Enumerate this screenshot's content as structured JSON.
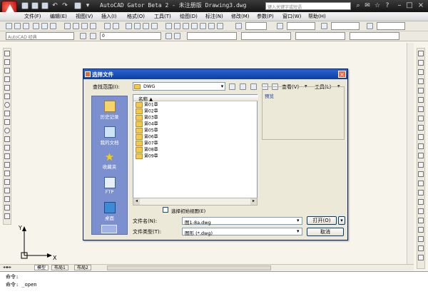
{
  "app": {
    "title": "AutoCAD Gator Beta 2 - 未注册版  Drawing3.dwg",
    "search_placeholder": "键入关键字或短语"
  },
  "menu": [
    "文件(F)",
    "编辑(E)",
    "视图(V)",
    "插入(I)",
    "格式(O)",
    "工具(T)",
    "绘图(D)",
    "标注(N)",
    "修改(M)",
    "参数(P)",
    "窗口(W)",
    "帮助(H)"
  ],
  "toolbar2": {
    "workspace": "AutoCAD 经典",
    "layer_value": "0"
  },
  "dialog": {
    "title": "选择文件",
    "lookin_label": "查找范围(I):",
    "lookin_value": "DWG",
    "views_label": "查看(V)",
    "tools_label": "工具(L)",
    "preview_label": "预览",
    "column_name": "名称",
    "places": [
      "历史记录",
      "我的文档",
      "收藏夹",
      "FTP",
      "桌面"
    ],
    "folders": [
      "第01章",
      "第02章",
      "第03章",
      "第04章",
      "第05章",
      "第06章",
      "第07章",
      "第08章",
      "第09章"
    ],
    "partial_open_label": "选择初始视图(E)",
    "filename_label": "文件名(N):",
    "filename_value": "图1-8a.dwg",
    "filetype_label": "文件类型(T):",
    "filetype_value": "图形 (*.dwg)",
    "open_label": "打开(O)",
    "cancel_label": "取消"
  },
  "tabs": [
    "模型",
    "布局1",
    "布局2"
  ],
  "ucs": {
    "x": "X",
    "y": "Y"
  },
  "command": {
    "line1": "命令:",
    "line2": "命令: _open"
  }
}
